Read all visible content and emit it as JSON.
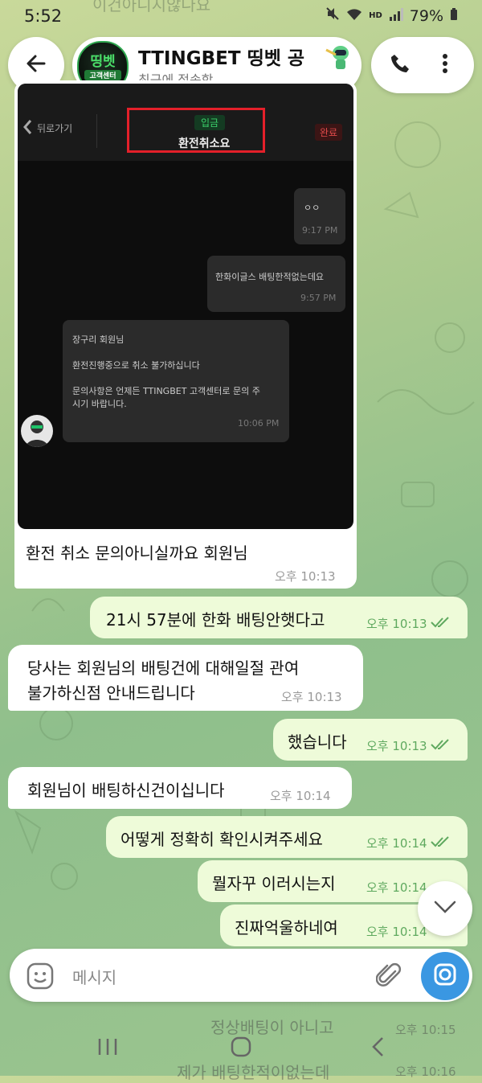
{
  "status_bar": {
    "time": "5:52",
    "battery": "79%",
    "hd_label": "HD",
    "ghost_text": "이건아니지않나요"
  },
  "header": {
    "title": "TTINGBET 띵벳 공",
    "subtitle": "최근에 접속함",
    "avatar_line1": "띵벳",
    "avatar_line2": "고객센터"
  },
  "screenshot": {
    "back_label": "뒤로가기",
    "tag": "입금",
    "title": "환전취소요",
    "status": "완료",
    "bubble1_text": "ㅇㅇ",
    "bubble1_time": "9:17 PM",
    "bubble2_text": "한화이글스 배팅한적없는데요",
    "bubble2_time": "9:57 PM",
    "bubble3_line1": "장구리 회원님",
    "bubble3_line2": "환전진행중으로 취소 불가하십니다",
    "bubble3_line3": "문의사항은 언제든 TTINGBET 고객센터로 문의 주",
    "bubble3_line4": "시기 바랍니다.",
    "bubble3_time": "10:06 PM"
  },
  "messages": [
    {
      "dir": "in",
      "text": "환전 취소 문의아니실까요 회원님",
      "time": "오후 10:13"
    },
    {
      "dir": "out",
      "text": "21시 57분에 한화 배팅안햇다고",
      "time": "오후 10:13"
    },
    {
      "dir": "in",
      "text": "당사는 회원님의 배팅건에 대해일절 관여",
      "text2": "불가하신점 안내드립니다",
      "time": "오후 10:13"
    },
    {
      "dir": "out",
      "text": "했습니다",
      "time": "오후 10:13"
    },
    {
      "dir": "in",
      "text": "회원님이 배팅하신건이십니다",
      "time": "오후 10:14"
    },
    {
      "dir": "out",
      "text": "어떻게 정확히 확인시켜주세요",
      "time": "오후 10:14"
    },
    {
      "dir": "out",
      "text": "뭘자꾸 이러시는지",
      "time": "오후 10:14"
    },
    {
      "dir": "out",
      "text": "진짜억울하네여",
      "time": "오후 10:14"
    }
  ],
  "below_messages": [
    {
      "text": "정상배팅이 아니고",
      "time": "오후 10:15"
    },
    {
      "text": "제가 배팅한적이없는데",
      "time": "오후 10:16"
    }
  ],
  "input": {
    "placeholder": "메시지"
  },
  "colors": {
    "accent": "#3a97e2",
    "outgoing_bubble": "#eefbd9",
    "check": "#5fa95f"
  }
}
